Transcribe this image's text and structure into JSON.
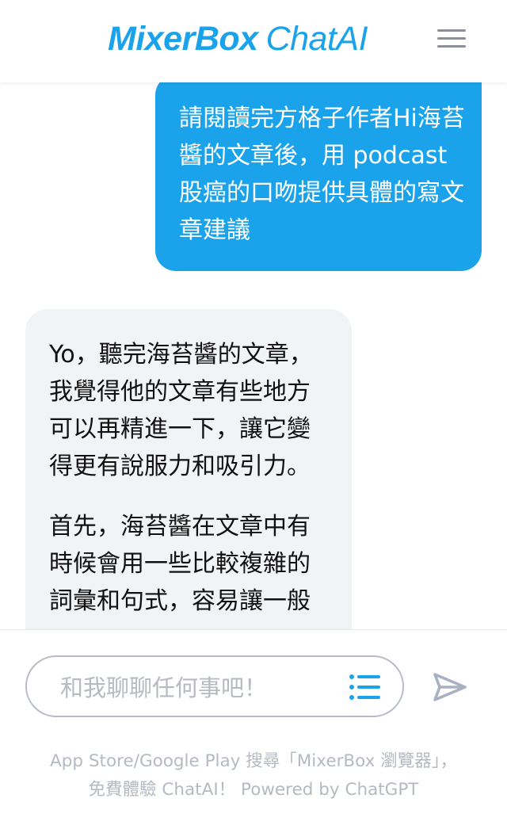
{
  "header": {
    "logo_brand": "MixerBox",
    "logo_product": "ChatAI",
    "brand_color": "#1aa3ea"
  },
  "chat": {
    "user_message": "請閱讀完方格子作者Hi海苔醬的文章後，用 podcast 股癌的口吻提供具體的寫文章建議",
    "bot_paragraphs": [
      "Yo，聽完海苔醬的文章，我覺得他的文章有些地方可以再精進一下，讓它變得更有說服力和吸引力。",
      "首先，海苔醬在文章中有時候會用一些比較複雜的詞彙和句式，容易讓一般"
    ]
  },
  "input": {
    "placeholder": "和我聊聊任何事吧！",
    "list_icon": "list-icon",
    "send_icon": "send-icon"
  },
  "footer": {
    "line1": "App Store/Google Play 搜尋「MixerBox 瀏覽器」，",
    "line2": "免費體驗 ChatAI！ Powered by ChatGPT"
  }
}
